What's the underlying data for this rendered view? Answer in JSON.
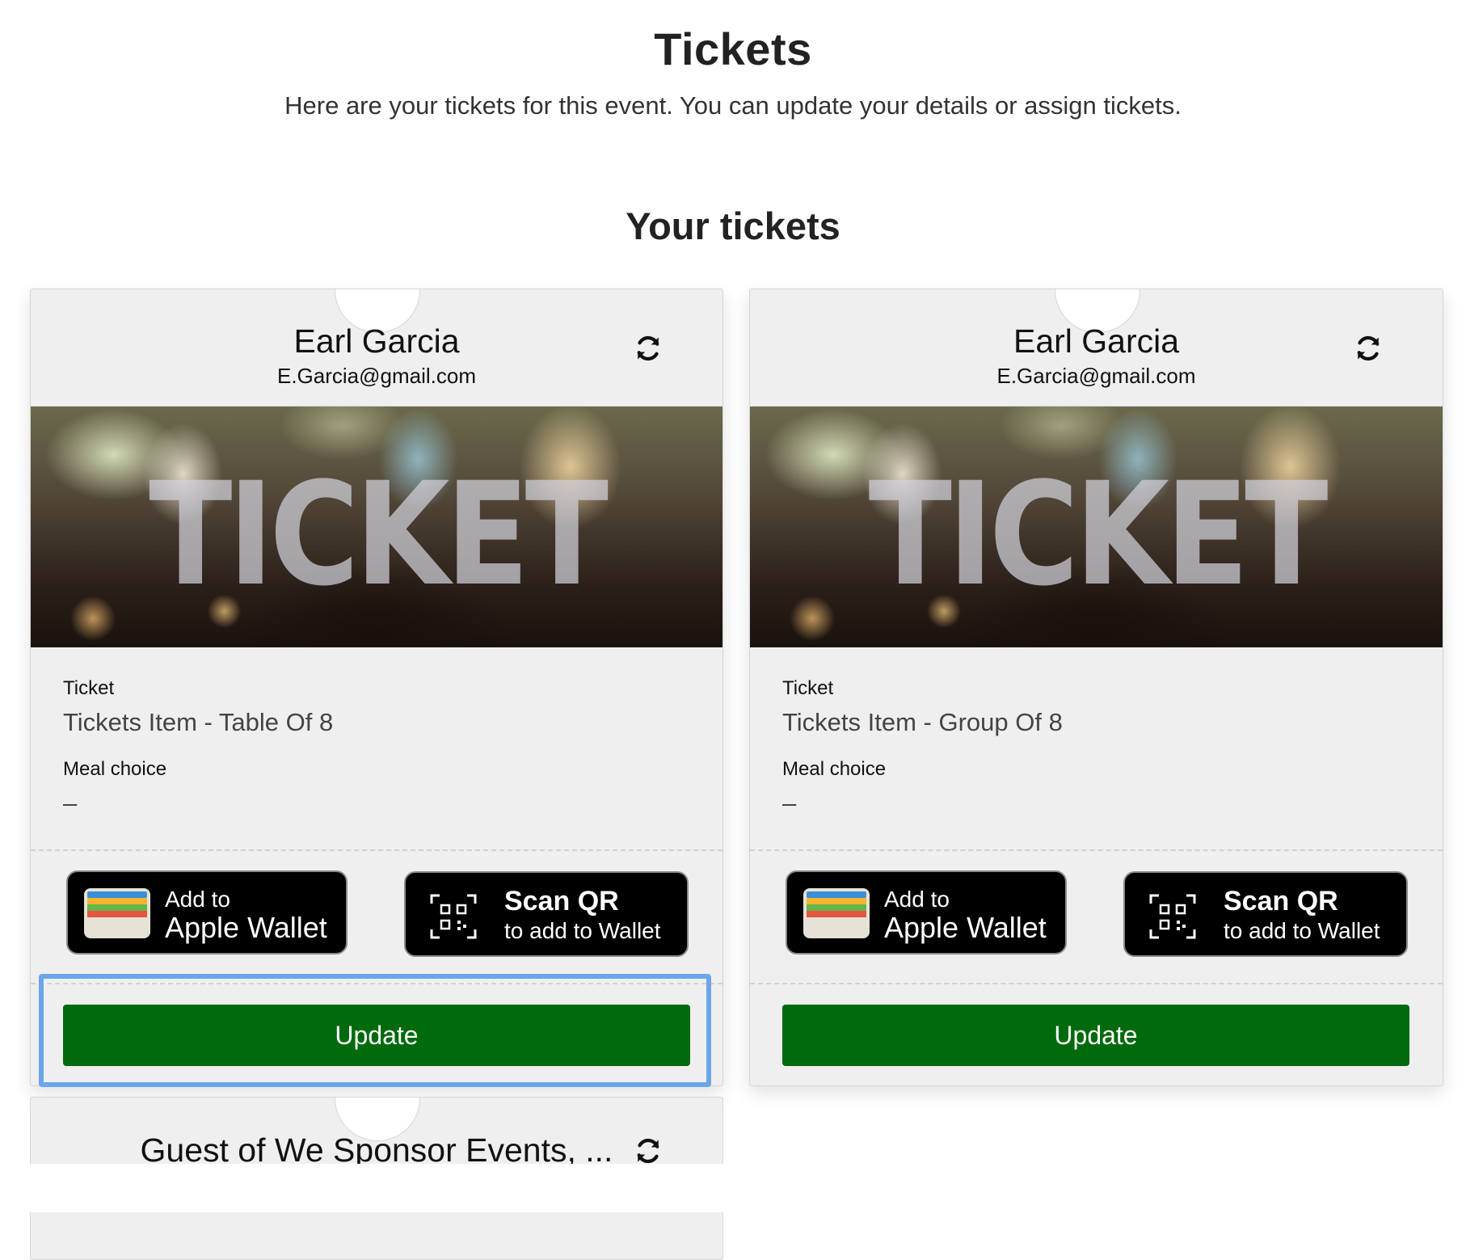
{
  "header": {
    "title": "Tickets",
    "subtitle": "Here are your tickets for this event. You can update your details or assign tickets."
  },
  "section_title": "Your tickets",
  "tickets": [
    {
      "name": "Earl Garcia",
      "email": "E.Garcia@gmail.com",
      "banner_text": "TICKET",
      "ticket_label": "Ticket",
      "ticket_value": "Tickets Item - Table Of 8",
      "meal_label": "Meal choice",
      "meal_value": "–",
      "wallet_line1": "Add to",
      "wallet_line2": "Apple Wallet",
      "qr_line1": "Scan QR",
      "qr_line2": "to add to Wallet",
      "update_label": "Update"
    },
    {
      "name": "Earl Garcia",
      "email": "E.Garcia@gmail.com",
      "banner_text": "TICKET",
      "ticket_label": "Ticket",
      "ticket_value": "Tickets Item - Group Of 8",
      "meal_label": "Meal choice",
      "meal_value": "–",
      "wallet_line1": "Add to",
      "wallet_line2": "Apple Wallet",
      "qr_line1": "Scan QR",
      "qr_line2": "to add to Wallet",
      "update_label": "Update"
    },
    {
      "name": "Guest of We Sponsor Events, ..."
    }
  ],
  "colors": {
    "update_green": "#006a0c",
    "highlight_blue": "#6aa6ea"
  },
  "icons": [
    "refresh-icon",
    "apple-wallet-icon",
    "qr-code-icon"
  ]
}
